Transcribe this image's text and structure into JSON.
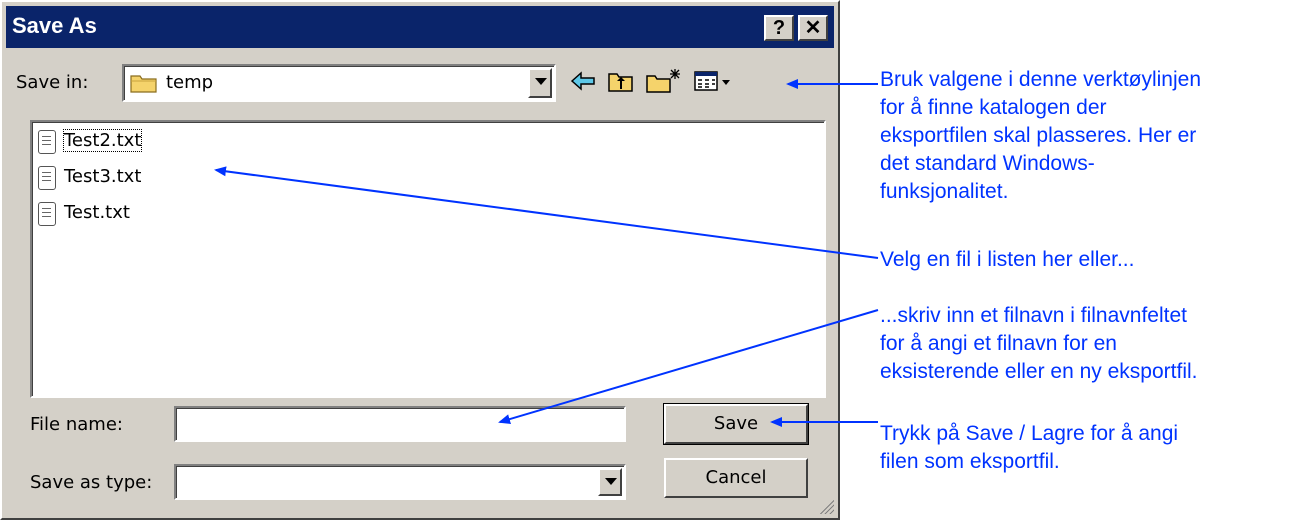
{
  "window": {
    "title": "Save As",
    "help_label": "?",
    "close_label": "✕"
  },
  "toolbar": {
    "save_in_label": "Save in:",
    "folder": "temp",
    "icons": [
      "back-icon",
      "up-folder-icon",
      "new-folder-icon",
      "view-menu-icon"
    ]
  },
  "files": [
    {
      "name": "Test2.txt"
    },
    {
      "name": "Test3.txt"
    },
    {
      "name": "Test.txt"
    }
  ],
  "form": {
    "file_name_label": "File name:",
    "file_name_value": "",
    "save_as_type_label": "Save as type:",
    "save_as_type_value": ""
  },
  "buttons": {
    "save": "Save",
    "cancel": "Cancel"
  },
  "annotations": [
    {
      "lines": [
        "Bruk valgene i denne verktøylinjen",
        "for å finne katalogen der",
        "eksportfilen skal plasseres. Her er",
        "det standard Windows-",
        "funksjonalitet."
      ]
    },
    {
      "lines": [
        "Velg en fil i listen her eller..."
      ]
    },
    {
      "lines": [
        "...skriv inn et filnavn i filnavnfeltet",
        "for å angi et filnavn for en",
        "eksisterende eller en ny eksportfil."
      ]
    },
    {
      "lines": [
        "Trykk på Save / Lagre for å angi",
        "filen som eksportfil."
      ]
    }
  ],
  "colors": {
    "titlebar": "#0a246a",
    "dialog_face": "#d4d0c8",
    "annotation": "#0033ff"
  }
}
